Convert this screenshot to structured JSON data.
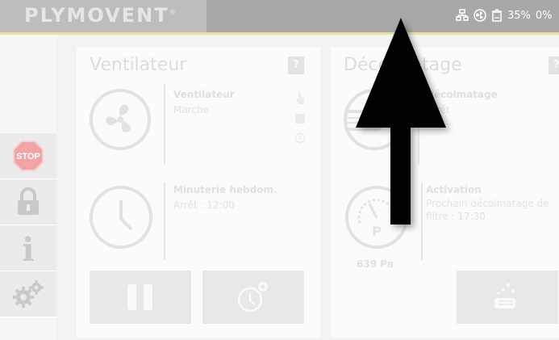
{
  "header": {
    "logo_text": "PLYMOVENT",
    "registered_mark": "®",
    "battery_percent": "35%",
    "trailing_text": "0%"
  },
  "nav": {
    "stop_label": "STOP",
    "info_label": "i"
  },
  "cards": {
    "fan": {
      "title": "Ventilateur",
      "help_label": "?",
      "status_title": "Ventilateur",
      "status_value": "Marche",
      "timer_title": "Minuterie hebdom.",
      "timer_value": "Arrêt : 12:00"
    },
    "cleaning": {
      "title": "Décolmatage",
      "help_label": "?",
      "status_title": "Décolmatage",
      "status_value": "Arrêt",
      "activation_title": "Activation",
      "activation_line1": "Prochain décolmatage de",
      "activation_line2": "filtre : 17:30",
      "pressure": "639 Pa",
      "gauge_letter": "P"
    }
  },
  "colors": {
    "topbar": "#a8a8a8",
    "logo_area": "#bdbdbd",
    "accent_line": "#e8e0a0",
    "stop": "#f2a4a4"
  }
}
